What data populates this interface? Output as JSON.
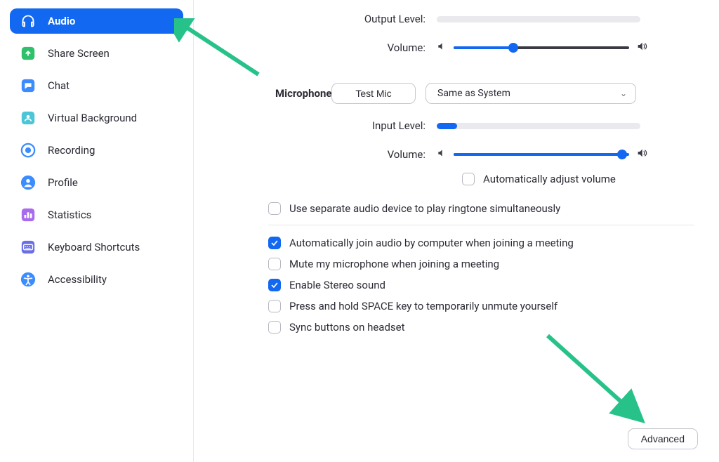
{
  "sidebar": {
    "items": [
      {
        "label": "Audio",
        "icon": "headphones-icon",
        "active": true,
        "color": "#1268f0"
      },
      {
        "label": "Share Screen",
        "icon": "share-screen-icon",
        "active": false,
        "color": "#2ec06a"
      },
      {
        "label": "Chat",
        "icon": "chat-icon",
        "active": false,
        "color": "#3b8cff"
      },
      {
        "label": "Virtual Background",
        "icon": "virtual-background-icon",
        "active": false,
        "color": "#4cc5d6"
      },
      {
        "label": "Recording",
        "icon": "recording-icon",
        "active": false,
        "color": "#3b8cff"
      },
      {
        "label": "Profile",
        "icon": "profile-icon",
        "active": false,
        "color": "#3b8cff"
      },
      {
        "label": "Statistics",
        "icon": "statistics-icon",
        "active": false,
        "color": "#a96bed"
      },
      {
        "label": "Keyboard Shortcuts",
        "icon": "keyboard-icon",
        "active": false,
        "color": "#6b6fe6"
      },
      {
        "label": "Accessibility",
        "icon": "accessibility-icon",
        "active": false,
        "color": "#3b8cff"
      }
    ]
  },
  "speaker": {
    "output_level_label": "Output Level:",
    "output_level_percent": 0,
    "volume_label": "Volume:",
    "volume_percent": 34
  },
  "microphone": {
    "section_label": "Microphone",
    "test_button_label": "Test Mic",
    "device_selected": "Same as System",
    "input_level_label": "Input Level:",
    "input_level_percent": 10,
    "volume_label": "Volume:",
    "volume_percent": 96,
    "auto_adjust_label": "Automatically adjust volume",
    "auto_adjust_checked": false
  },
  "options": {
    "ringtone": {
      "label": "Use separate audio device to play ringtone simultaneously",
      "checked": false
    },
    "list": [
      {
        "label": "Automatically join audio by computer when joining a meeting",
        "checked": true
      },
      {
        "label": "Mute my microphone when joining a meeting",
        "checked": false
      },
      {
        "label": "Enable Stereo sound",
        "checked": true
      },
      {
        "label": "Press and hold SPACE key to temporarily unmute yourself",
        "checked": false
      },
      {
        "label": "Sync buttons on headset",
        "checked": false
      }
    ]
  },
  "advanced_button_label": "Advanced"
}
